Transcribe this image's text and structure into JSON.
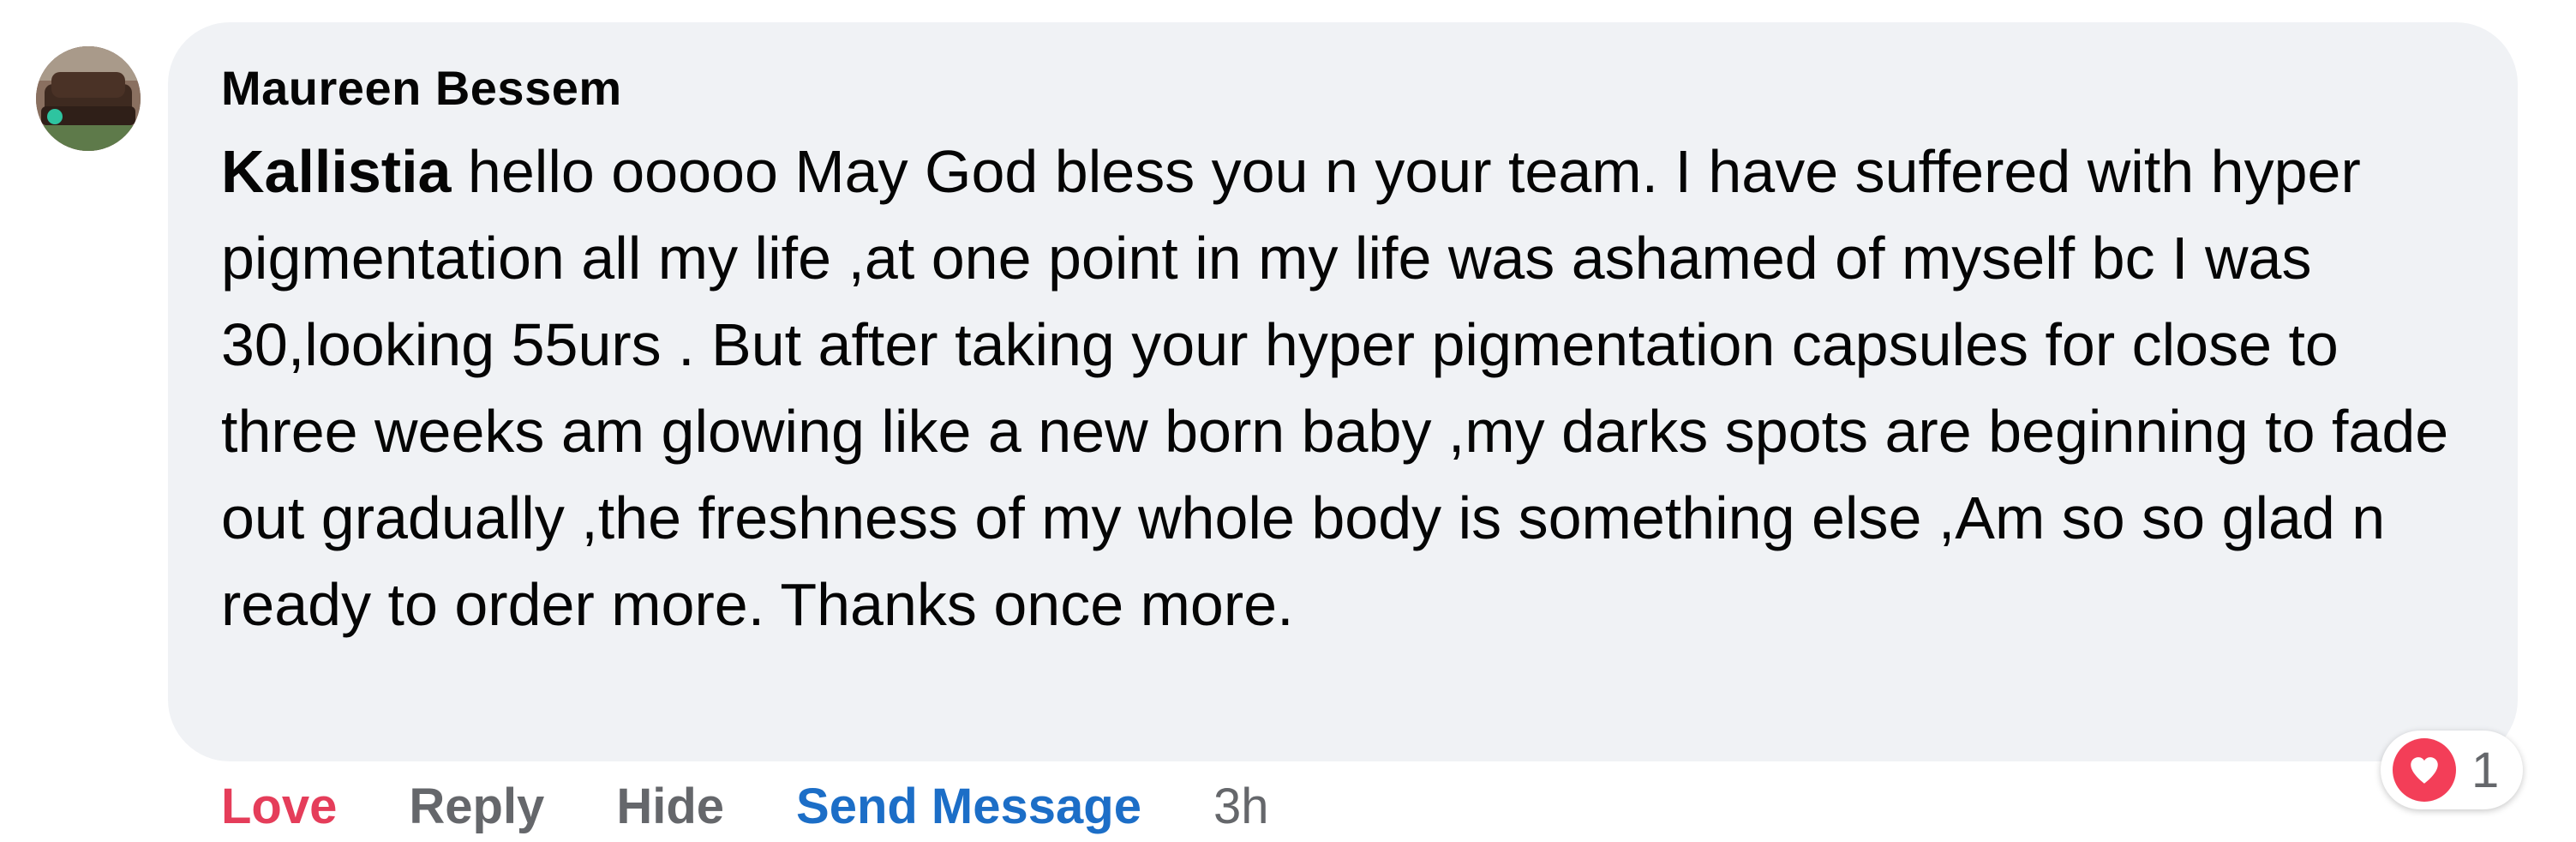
{
  "comment": {
    "author": "Maureen Bessem",
    "mention": "Kallistia",
    "text": " hello ooooo May God bless you n your team. I have suffered with hyper pigmentation all my life ,at one point in my life was ashamed of myself bc I was 30,looking 55urs . But after taking your hyper pigmentation capsules for close to three weeks am glowing like a new born baby ,my darks spots are beginning to fade out gradually ,the freshness of my whole body is something else ,Am so so glad n ready to order more. Thanks once more."
  },
  "actions": {
    "love": "Love",
    "reply": "Reply",
    "hide": "Hide",
    "send_message": "Send Message",
    "timestamp": "3h"
  },
  "reactions": {
    "icon": "heart-icon",
    "count": "1"
  },
  "colors": {
    "bubble": "#f0f2f5",
    "love": "#e53d5a",
    "link": "#1c6ec7",
    "muted": "#65676b",
    "heart": "#f33e58"
  }
}
